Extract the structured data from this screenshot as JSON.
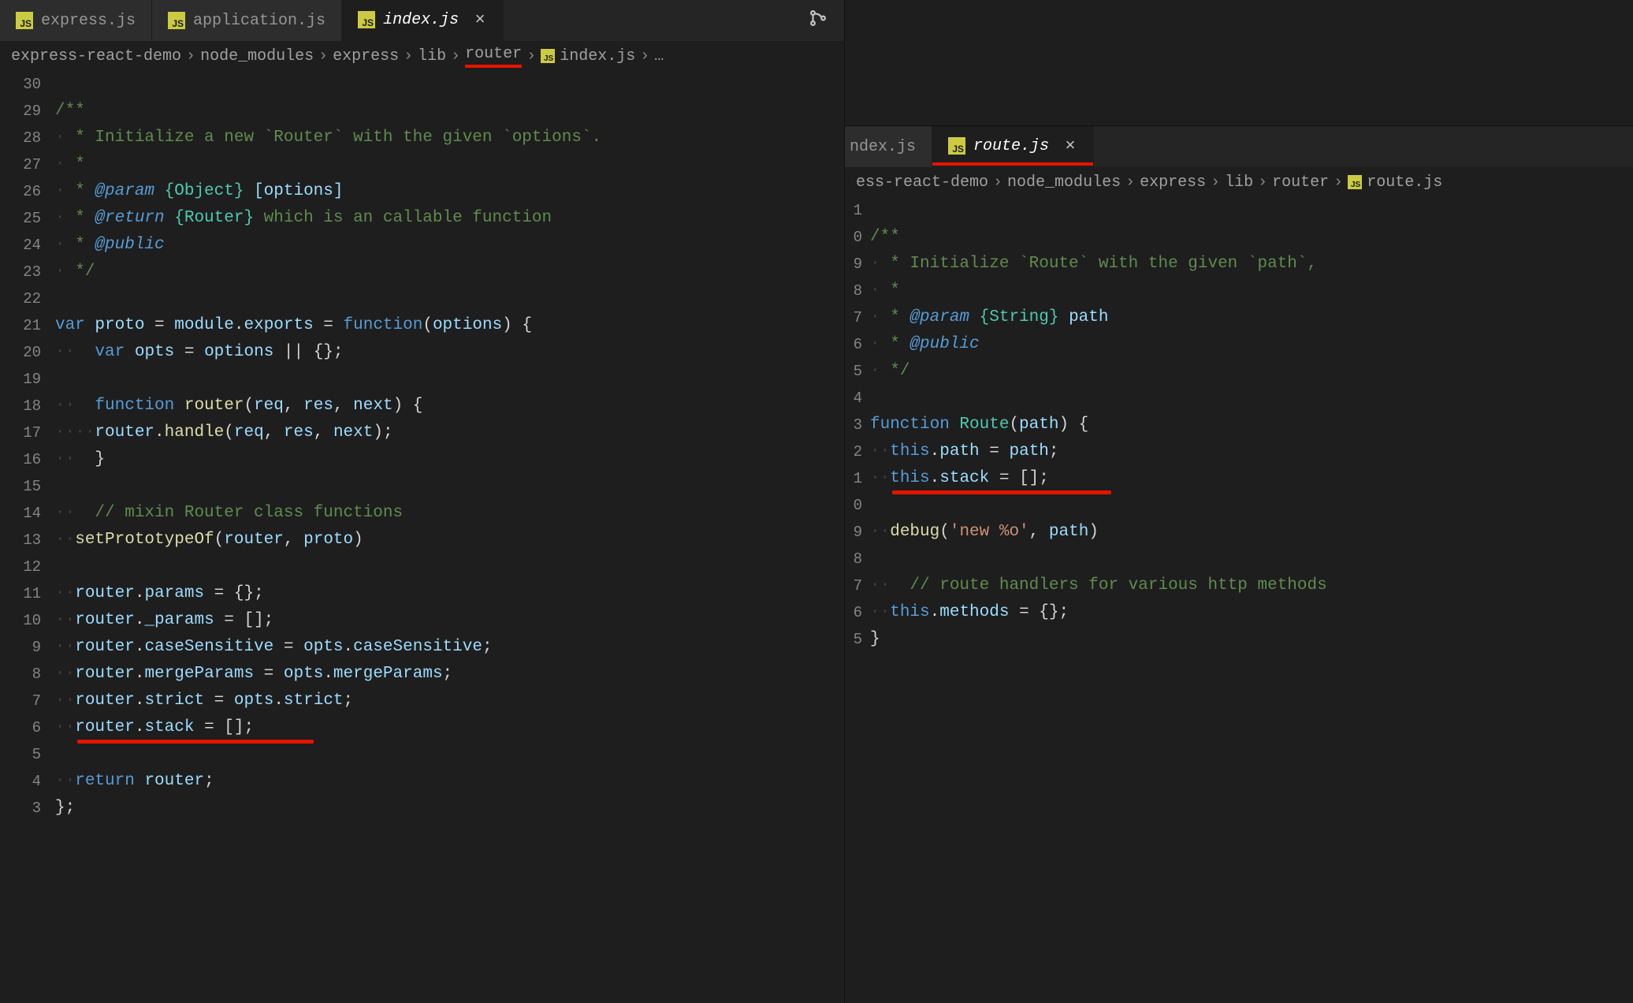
{
  "left": {
    "tabs": [
      {
        "label": "express.js",
        "active": false
      },
      {
        "label": "application.js",
        "active": false
      },
      {
        "label": "index.js",
        "active": true
      }
    ],
    "breadcrumbs": [
      "express-react-demo",
      "node_modules",
      "express",
      "lib",
      "router",
      "index.js",
      "…"
    ],
    "gutter": [
      "30",
      "29",
      "28",
      "27",
      "26",
      "25",
      "24",
      "23",
      "22",
      "21",
      "20",
      "19",
      "18",
      "17",
      "16",
      "15",
      "14",
      "13",
      "12",
      "11",
      "10",
      "9",
      "8",
      "7",
      "6",
      "5",
      "4",
      "3"
    ],
    "code": {
      "l1": "",
      "l2": "/**",
      "l3a": " * Initialize a new `Router` with the given `options`.",
      "l4": " *",
      "l5a": " * ",
      "l5b": "@param",
      "l5c": " {Object}",
      "l5d": " [options]",
      "l6a": " * ",
      "l6b": "@return",
      "l6c": " {Router}",
      "l6d": " which is an callable function",
      "l7a": " * ",
      "l7b": "@public",
      "l8": " */",
      "l9": "",
      "l10a": "var ",
      "l10b": "proto",
      "l10c": " = ",
      "l10d": "module",
      "l10e": ".",
      "l10f": "exports",
      "l10g": " = ",
      "l10h": "function",
      "l10i": "(",
      "l10j": "options",
      "l10k": ") {",
      "l11a": "  var ",
      "l11b": "opts",
      "l11c": " = ",
      "l11d": "options",
      "l11e": " || {};",
      "l12": "",
      "l13a": "  function ",
      "l13b": "router",
      "l13c": "(",
      "l13d": "req",
      "l13e": ", ",
      "l13f": "res",
      "l13g": ", ",
      "l13h": "next",
      "l13i": ") {",
      "l14a": "    ",
      "l14b": "router",
      "l14c": ".",
      "l14d": "handle",
      "l14e": "(",
      "l14f": "req",
      "l14g": ", ",
      "l14h": "res",
      "l14i": ", ",
      "l14j": "next",
      "l14k": ");",
      "l15": "  }",
      "l16": "",
      "l17": "  // mixin Router class functions",
      "l18a": "  ",
      "l18b": "setPrototypeOf",
      "l18c": "(",
      "l18d": "router",
      "l18e": ", ",
      "l18f": "proto",
      "l18g": ")",
      "l19": "",
      "l20a": "  ",
      "l20b": "router",
      "l20c": ".",
      "l20d": "params",
      "l20e": " = {};",
      "l21a": "  ",
      "l21b": "router",
      "l21c": ".",
      "l21d": "_params",
      "l21e": " = [];",
      "l22a": "  ",
      "l22b": "router",
      "l22c": ".",
      "l22d": "caseSensitive",
      "l22e": " = ",
      "l22f": "opts",
      "l22g": ".",
      "l22h": "caseSensitive",
      "l22i": ";",
      "l23a": "  ",
      "l23b": "router",
      "l23c": ".",
      "l23d": "mergeParams",
      "l23e": " = ",
      "l23f": "opts",
      "l23g": ".",
      "l23h": "mergeParams",
      "l23i": ";",
      "l24a": "  ",
      "l24b": "router",
      "l24c": ".",
      "l24d": "strict",
      "l24e": " = ",
      "l24f": "opts",
      "l24g": ".",
      "l24h": "strict",
      "l24i": ";",
      "l25a": "  ",
      "l25b": "router",
      "l25c": ".",
      "l25d": "stack",
      "l25e": " = [];",
      "l26": "",
      "l27a": "  ",
      "l27b": "return ",
      "l27c": "router",
      "l27d": ";",
      "l28": "};"
    }
  },
  "right": {
    "tabs": [
      {
        "label": "ndex.js",
        "active": false
      },
      {
        "label": "route.js",
        "active": true
      }
    ],
    "breadcrumbs_partial_first": "ess-react-demo",
    "breadcrumbs": [
      "node_modules",
      "express",
      "lib",
      "router",
      "route.js"
    ],
    "gutter": [
      "1",
      "0",
      "9",
      "8",
      "7",
      "6",
      "5",
      "4",
      "3",
      "2",
      "1",
      "0",
      "9",
      "8",
      "7",
      "6",
      "5"
    ],
    "code": {
      "l1": "",
      "l2": "/**",
      "l3": " * Initialize `Route` with the given `path`,",
      "l4": " *",
      "l5a": " * ",
      "l5b": "@param",
      "l5c": " {String}",
      "l5d": " path",
      "l6a": " * ",
      "l6b": "@public",
      "l7": " */",
      "l8": "",
      "l9a": "function ",
      "l9b": "Route",
      "l9c": "(",
      "l9d": "path",
      "l9e": ") {",
      "l10a": "  ",
      "l10b": "this",
      "l10c": ".",
      "l10d": "path",
      "l10e": " = ",
      "l10f": "path",
      "l10g": ";",
      "l11a": "  ",
      "l11b": "this",
      "l11c": ".",
      "l11d": "stack",
      "l11e": " = [];",
      "l12": "",
      "l13a": "  ",
      "l13b": "debug",
      "l13c": "(",
      "l13d": "'new %o'",
      "l13e": ", ",
      "l13f": "path",
      "l13g": ")",
      "l14": "",
      "l15": "  // route handlers for various http methods",
      "l16a": "  ",
      "l16b": "this",
      "l16c": ".",
      "l16d": "methods",
      "l16e": " = {};",
      "l17": "}"
    }
  },
  "icon_js": "JS"
}
